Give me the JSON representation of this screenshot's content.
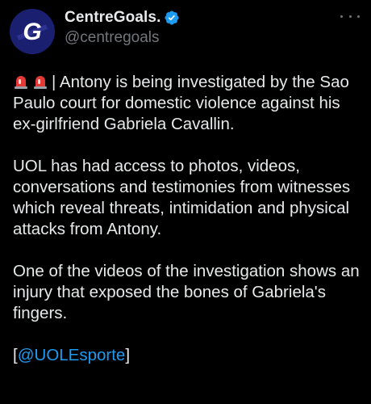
{
  "author": {
    "display_name": "CentreGoals.",
    "handle": "@centregoals",
    "avatar_letter": "G",
    "avatar_icon": "centregoals-logo",
    "verified_icon": "verified-badge-icon",
    "more_icon": "more-options-icon"
  },
  "tweet": {
    "siren_icon": "police-car-light-emoji",
    "p1": "| Antony is being investigated by the Sao Paulo court for domestic violence against his ex-girlfriend Gabriela Cavallin.",
    "p2": "UOL has had access to photos, videos, conversations and testimonies from witnesses which reveal threats, intimidation and physical attacks from Antony.",
    "p3": "One of the videos of the investigation shows an injury that exposed the bones of Gabriela's fingers.",
    "mention_open": "[",
    "mention": "@UOLEsporte",
    "mention_close": "]"
  },
  "colors": {
    "background": "#000000",
    "text": "#e7e9ea",
    "muted": "#71767b",
    "link": "#1d9bf0",
    "verified": "#1d9bf0"
  }
}
